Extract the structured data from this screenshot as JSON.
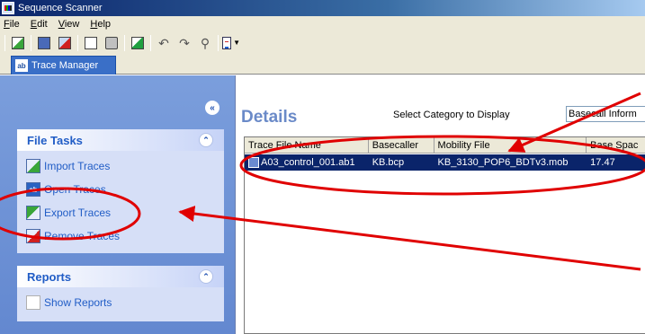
{
  "window": {
    "title": "Sequence Scanner"
  },
  "menu": [
    {
      "label": "File",
      "accel": "F",
      "rest": "ile"
    },
    {
      "label": "Edit",
      "accel": "E",
      "rest": "dit"
    },
    {
      "label": "View",
      "accel": "V",
      "rest": "iew"
    },
    {
      "label": "Help",
      "accel": "H",
      "rest": "elp"
    }
  ],
  "tab": {
    "label": "Trace Manager",
    "icon_text": "ab"
  },
  "left": {
    "file_tasks": {
      "title": "File Tasks",
      "items": [
        {
          "label": "Import Traces",
          "icon": "import-icon"
        },
        {
          "label": "Open Traces",
          "icon": "open-icon"
        },
        {
          "label": "Export Traces",
          "icon": "export-icon"
        },
        {
          "label": "Remove Traces",
          "icon": "remove-icon"
        }
      ]
    },
    "reports": {
      "title": "Reports",
      "items": [
        {
          "label": "Show Reports",
          "icon": "reports-icon"
        }
      ]
    }
  },
  "details": {
    "title": "Details",
    "category_label": "Select Category to Display",
    "category_value": "Basecall Inform",
    "columns": [
      "Trace File Name",
      "Basecaller",
      "Mobility File",
      "Base Spac"
    ],
    "rows": [
      {
        "name": "A03_control_001.ab1",
        "basecaller": "KB.bcp",
        "mobility": "KB_3130_POP6_BDTv3.mob",
        "spacing": "17.47"
      }
    ]
  },
  "colors": {
    "accent": "#215dc6",
    "selection": "#0a246a",
    "annotation": "#e00000",
    "details_title": "#6a8ac8"
  }
}
